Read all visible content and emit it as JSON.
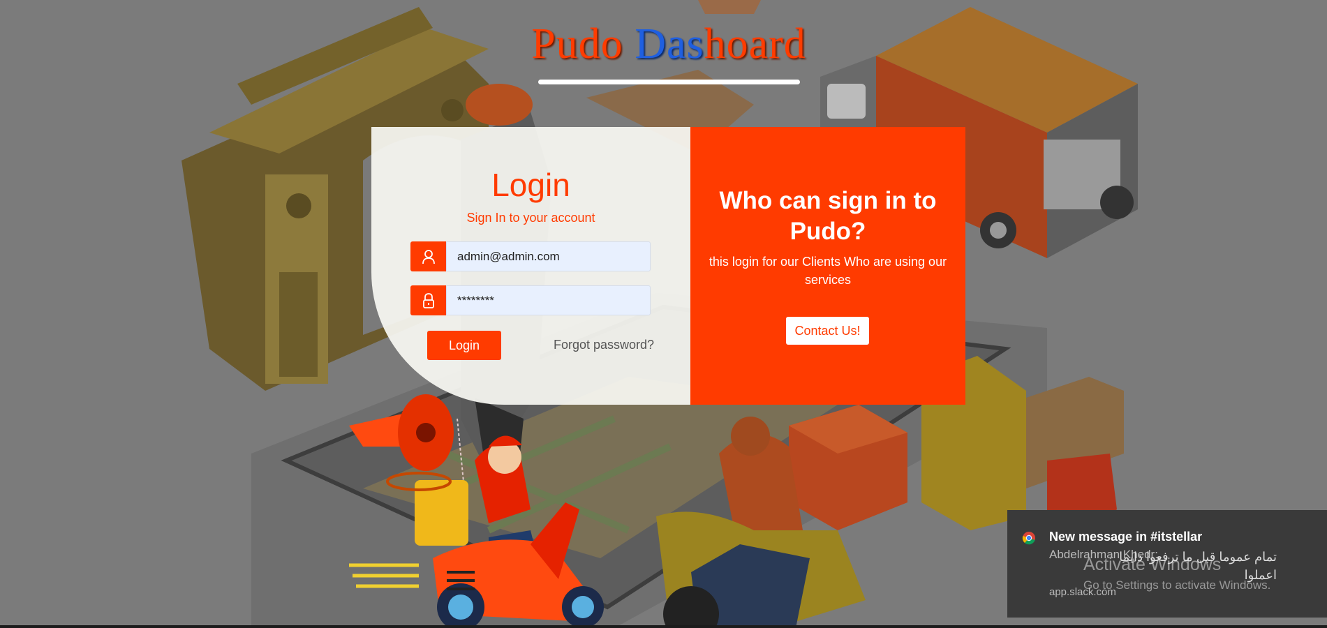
{
  "header": {
    "title_part1": "Pudo ",
    "title_part2": "Das",
    "title_part3": "hoard"
  },
  "login": {
    "heading": "Login",
    "subtitle": "Sign In to your account",
    "email_value": "admin@admin.com",
    "password_value": "********",
    "login_button": "Login",
    "forgot_link": "Forgot password?"
  },
  "info": {
    "heading": "Who can sign in to Pudo?",
    "description": "this login for our Clients Who are using our services",
    "contact_button": "Contact Us!"
  },
  "notification": {
    "title": "New message in #itstellar",
    "sender": "Abdelrahman Khedr:",
    "message": "تمام عموما قبل ما ترفعوا دايما اعملوا",
    "source": "app.slack.com"
  },
  "watermark": {
    "line1": "Activate Windows",
    "line2": "Go to Settings to activate Windows."
  },
  "colors": {
    "accent": "#ff3b00",
    "title_blue": "#1f5fe0",
    "input_bg": "#e8f0fe"
  },
  "icons": {
    "email": "user-icon",
    "password": "lock-icon",
    "toast": "chrome-icon"
  }
}
